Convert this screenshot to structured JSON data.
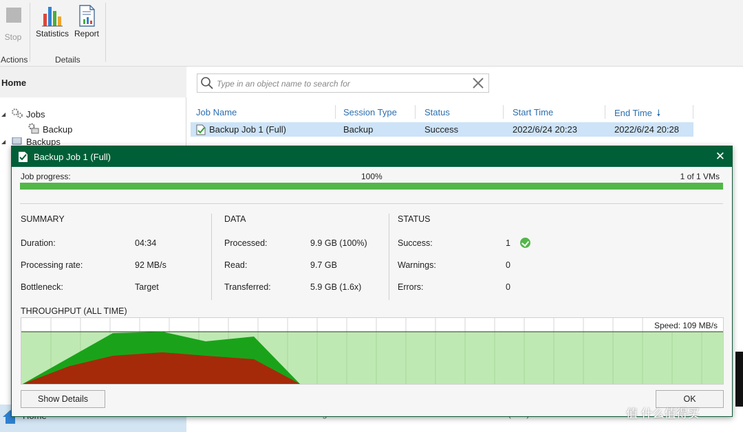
{
  "ribbon": {
    "stop_label": "Stop",
    "statistics_label": "Statistics",
    "report_label": "Report",
    "group_actions": "Actions",
    "group_details": "Details"
  },
  "nav": {
    "header": "Home",
    "jobs": "Jobs",
    "backup": "Backup",
    "backups": "Backups",
    "footer_home": "Home"
  },
  "search": {
    "placeholder": "Type in an object name to search for"
  },
  "grid": {
    "columns": [
      "Job Name",
      "Session Type",
      "Status",
      "Start Time",
      "End Time"
    ],
    "rows": [
      {
        "job_name": "Backup Job 1 (Full)",
        "session_type": "Backup",
        "status": "Success",
        "start_time": "2022/6/24 20:23",
        "end_time": "2022/6/24 20:28"
      }
    ],
    "bottom_strip": [
      "Bottleneck:",
      "Target",
      "Transferred:",
      "5.9 GB (1.6x)",
      "Errors:"
    ]
  },
  "dialog": {
    "title": "Backup Job 1 (Full)",
    "progress_label": "Job progress:",
    "progress_percent_text": "100%",
    "progress_value": 1.0,
    "vms_text": "1 of 1 VMs",
    "summary": {
      "title": "SUMMARY",
      "duration_label": "Duration:",
      "duration": "04:34",
      "rate_label": "Processing rate:",
      "rate": "92 MB/s",
      "bottleneck_label": "Bottleneck:",
      "bottleneck": "Target"
    },
    "data": {
      "title": "DATA",
      "processed_label": "Processed:",
      "processed": "9.9 GB (100%)",
      "read_label": "Read:",
      "read": "9.7 GB",
      "transferred_label": "Transferred:",
      "transferred": "5.9 GB (1.6x)"
    },
    "status": {
      "title": "STATUS",
      "success_label": "Success:",
      "success": "1",
      "warnings_label": "Warnings:",
      "warnings": "0",
      "errors_label": "Errors:",
      "errors": "0"
    },
    "throughput_title": "THROUGHPUT (ALL TIME)",
    "speed": "Speed: 109 MB/s",
    "show_details": "Show Details",
    "ok": "OK"
  },
  "colors": {
    "title_bar": "#005f37",
    "progress": "#52b748",
    "chart_bg": "#bfe9b3",
    "processing": "#1aa31a",
    "transfer": "#a52a0a",
    "selection": "#cde3f7"
  },
  "watermark": "值 什么值得买"
}
